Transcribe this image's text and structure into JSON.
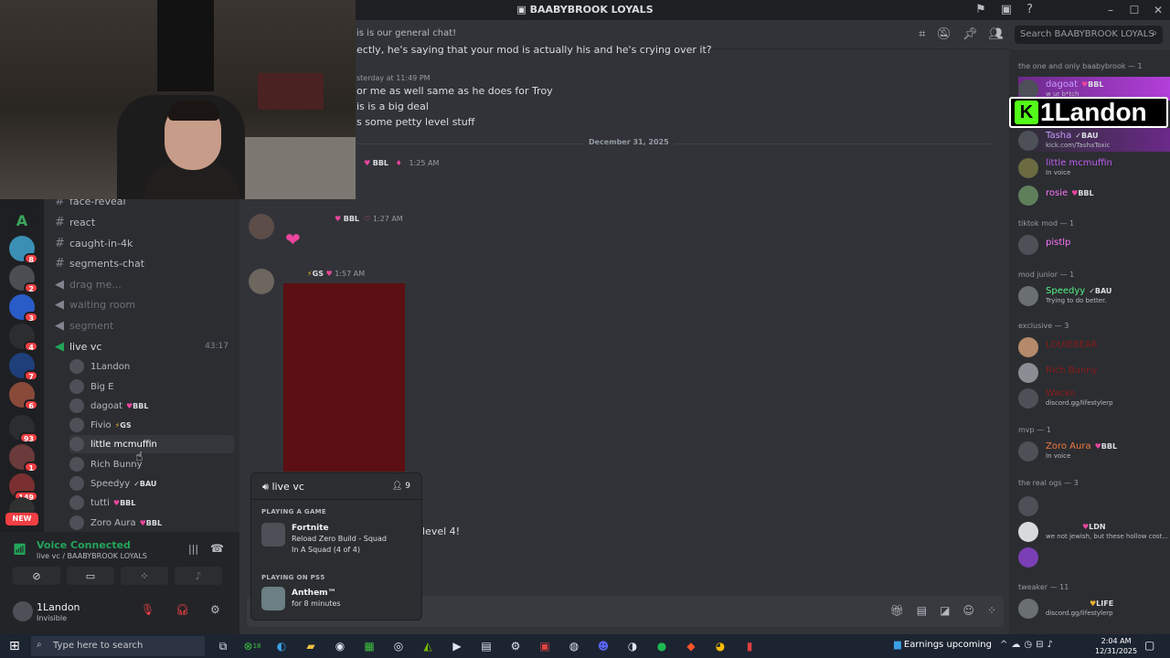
{
  "window": {
    "title": "BAABYBROOK LOYALS"
  },
  "colors": {
    "accent": "#5865f2",
    "online": "#23a55a",
    "danger": "#f23f43",
    "pink": "#eb459e",
    "gold": "#f0b232"
  },
  "server_badges": [
    "8",
    "2",
    "3",
    "4",
    "7",
    "6",
    "93",
    "1",
    "149",
    "66"
  ],
  "server_rail_new": "NEW",
  "rail_letter": "A",
  "channels": {
    "text": [
      "face-reveal",
      "react",
      "caught-in-4k",
      "segments-chat"
    ],
    "voice_muted": [
      "drag me...",
      "waiting room",
      "segment"
    ],
    "live": {
      "name": "live vc",
      "time": "43:17"
    }
  },
  "voice_users": [
    {
      "name": "1Landon",
      "tag": ""
    },
    {
      "name": "Big E",
      "tag": ""
    },
    {
      "name": "dagoat",
      "tag": "BBL"
    },
    {
      "name": "Fivio",
      "tag": "GS"
    },
    {
      "name": "little mcmuffin",
      "tag": ""
    },
    {
      "name": "Rich Bunny",
      "tag": ""
    },
    {
      "name": "Speedyy",
      "tag": "BAU"
    },
    {
      "name": "tutti",
      "tag": "BBL"
    },
    {
      "name": "Zoro Aura",
      "tag": "BBL"
    }
  ],
  "voice_panel": {
    "status": "Voice Connected",
    "location": "live vc / BAABYBROOK LOYALS"
  },
  "user_panel": {
    "name": "1Landon",
    "status": "Invisible"
  },
  "header": {
    "topic": "is is our general chat!",
    "search_placeholder": "Search BAABYBROOK LOYALS"
  },
  "messages": {
    "m1": "ectly, he's saying that your mod is actually his and he's crying over it?",
    "m2_ts": "sterday at 11:49 PM",
    "m2_lines": [
      "or me as well same as he does for Troy",
      "is is a big deal",
      "s some petty level stuff"
    ],
    "divider": "December 31, 2025",
    "m3_tag": "BBL",
    "m3_ts": "1:25 AM",
    "m4_tag": "BBL",
    "m4_ts": "1:27 AM",
    "m5_tag": "GS",
    "m5_ts": "1:57 AM",
    "m6_fragment": "level 4!"
  },
  "popover": {
    "title": "live vc",
    "count": "9",
    "section1": "PLAYING A GAME",
    "game1_name": "Fortnite",
    "game1_l1": "Reload Zero Build - Squad",
    "game1_l2": "In A Squad (4 of 4)",
    "section2": "PLAYING ON PS5",
    "game2_name": "Anthem™",
    "game2_l1": "for 8 minutes"
  },
  "members": {
    "g1": "the one and only baabybrook — 1",
    "dagoat": {
      "name": "dagoat",
      "tag": "BBL",
      "sub": "w ur b*tch"
    },
    "tasha": {
      "name": "Tasha",
      "tag": "BAU",
      "sub": "kick.com/TashaToxic"
    },
    "muffin": {
      "name": "little mcmuffin",
      "sub": "In voice"
    },
    "rosie": {
      "name": "rosie",
      "tag": "BBL"
    },
    "g2": "tiktok mod — 1",
    "pistlp": {
      "name": "pistlp"
    },
    "g3": "mod junior — 1",
    "speedyy": {
      "name": "Speedyy",
      "tag": "BAU",
      "sub": "Trying to do better."
    },
    "g4": "exclusive — 3",
    "louie": {
      "name": "LOUIEBEAR"
    },
    "rich": {
      "name": "Rich Bunny"
    },
    "wacko": {
      "name": "Wacko",
      "sub": "discord.gg/lifestylerp"
    },
    "g5": "mvp — 1",
    "zoro": {
      "name": "Zoro Aura",
      "tag": "BBL",
      "sub": "In voice"
    },
    "g6": "the real ogs — 3",
    "ldn": {
      "tag": "LDN",
      "sub": "we not jewish, but these hollow cost..."
    },
    "g7": "tweaker — 11",
    "life": {
      "tag": "LIFE",
      "sub": "discord.gg/lifestylerp"
    }
  },
  "overlay": {
    "k": "K",
    "name": "1Landon"
  },
  "taskbar": {
    "search": "Type here to search",
    "news": "Earnings upcoming",
    "time": "2:04 AM",
    "date": "12/31/2025",
    "badge": "18"
  }
}
